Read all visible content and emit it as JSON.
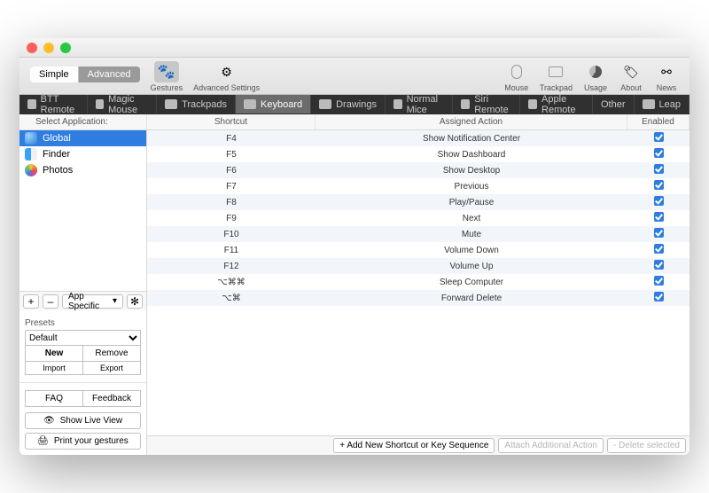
{
  "toolbar": {
    "seg": {
      "simple": "Simple",
      "advanced": "Advanced"
    },
    "gestures": "Gestures",
    "adv_settings": "Advanced Settings",
    "right": {
      "mouse": "Mouse",
      "trackpad": "Trackpad",
      "usage": "Usage",
      "about": "About",
      "news": "News"
    }
  },
  "tabs": {
    "btt": "BTT Remote",
    "magic": "Magic Mouse",
    "track": "Trackpads",
    "keyboard": "Keyboard",
    "drawings": "Drawings",
    "normal": "Normal Mice",
    "siri": "Siri Remote",
    "apple": "Apple Remote",
    "other": "Other",
    "leap": "Leap"
  },
  "cols": {
    "selectapp": "Select Application:",
    "shortcut": "Shortcut",
    "assigned": "Assigned Action",
    "enabled": "Enabled"
  },
  "apps": {
    "global": "Global",
    "finder": "Finder",
    "photos": "Photos"
  },
  "sidetool": {
    "add": "+",
    "remove": "–",
    "appspecific": "App Specific",
    "gear": "✻"
  },
  "presets": {
    "label": "Presets",
    "default": "Default",
    "new": "New",
    "remove": "Remove",
    "import": "Import",
    "export": "Export"
  },
  "bottom": {
    "faq": "FAQ",
    "feedback": "Feedback",
    "showlive": "Show Live View",
    "print": "Print your gestures"
  },
  "footer": {
    "add": "+ Add New Shortcut or Key Sequence",
    "attach": "Attach Additional Action",
    "delete": "- Delete selected"
  },
  "rows": [
    {
      "shortcut": "F4",
      "action": "Show Notification Center",
      "enabled": true
    },
    {
      "shortcut": "F5",
      "action": "Show Dashboard",
      "enabled": true
    },
    {
      "shortcut": "F6",
      "action": "Show Desktop",
      "enabled": true
    },
    {
      "shortcut": "F7",
      "action": "Previous",
      "enabled": true
    },
    {
      "shortcut": "F8",
      "action": "Play/Pause",
      "enabled": true
    },
    {
      "shortcut": "F9",
      "action": "Next",
      "enabled": true
    },
    {
      "shortcut": "F10",
      "action": "Mute",
      "enabled": true
    },
    {
      "shortcut": "F11",
      "action": "Volume Down",
      "enabled": true
    },
    {
      "shortcut": "F12",
      "action": "Volume Up",
      "enabled": true
    },
    {
      "shortcut": "⌥⌘⌘",
      "action": "Sleep Computer",
      "enabled": true
    },
    {
      "shortcut": "⌥⌘",
      "action": "Forward Delete",
      "enabled": true
    }
  ]
}
